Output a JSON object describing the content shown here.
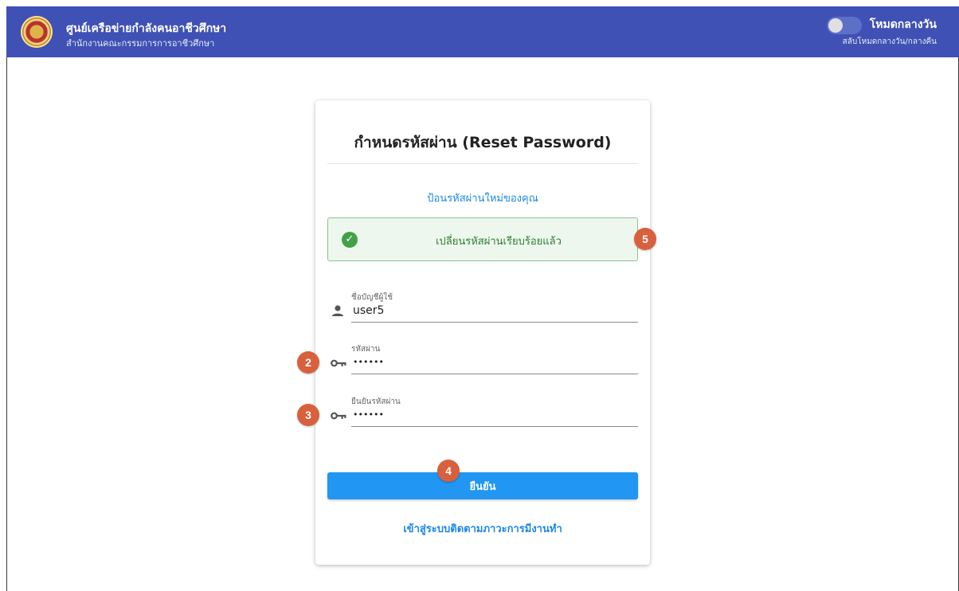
{
  "header": {
    "title": "ศูนย์เครือข่ายกำลังคนอาชีวศึกษา",
    "subtitle": "สำนักงานคณะกรรมการการอาชีวศึกษา",
    "mode_label": "โหมดกลางวัน",
    "mode_hint": "สลับโหมดกลางวัน/กลางคืน",
    "dark_mode_enabled": false
  },
  "card": {
    "title": "กำหนดรหัสผ่าน (Reset Password)",
    "subtitle": "ป้อนรหัสผ่านใหม่ของคุณ",
    "alert": {
      "type": "success",
      "text": "เปลี่ยนรหัสผ่านเรียบร้อยแล้ว"
    },
    "fields": {
      "username": {
        "label": "ชื่อบัญชีผู้ใช้",
        "value": "user5",
        "icon": "person-icon"
      },
      "password": {
        "label": "รหัสผ่าน",
        "value": "••••••",
        "icon": "key-icon"
      },
      "confirm_password": {
        "label": "ยืนยันรหัสผ่าน",
        "value": "••••••",
        "icon": "key-icon"
      }
    },
    "confirm_button": "ยืนยัน",
    "link": "เข้าสู่ระบบติดตามภาวะการมีงานทำ"
  },
  "annotations": {
    "password": "2",
    "confirm_password": "3",
    "confirm_button": "4",
    "alert": "5"
  },
  "colors": {
    "header": "#3f51b5",
    "accent": "#2196f3",
    "link": "#1e88e5",
    "success_bg": "#edf7ed",
    "success_border": "#8bc48a",
    "success_icon": "#43a047",
    "badge": "#d9603d"
  }
}
